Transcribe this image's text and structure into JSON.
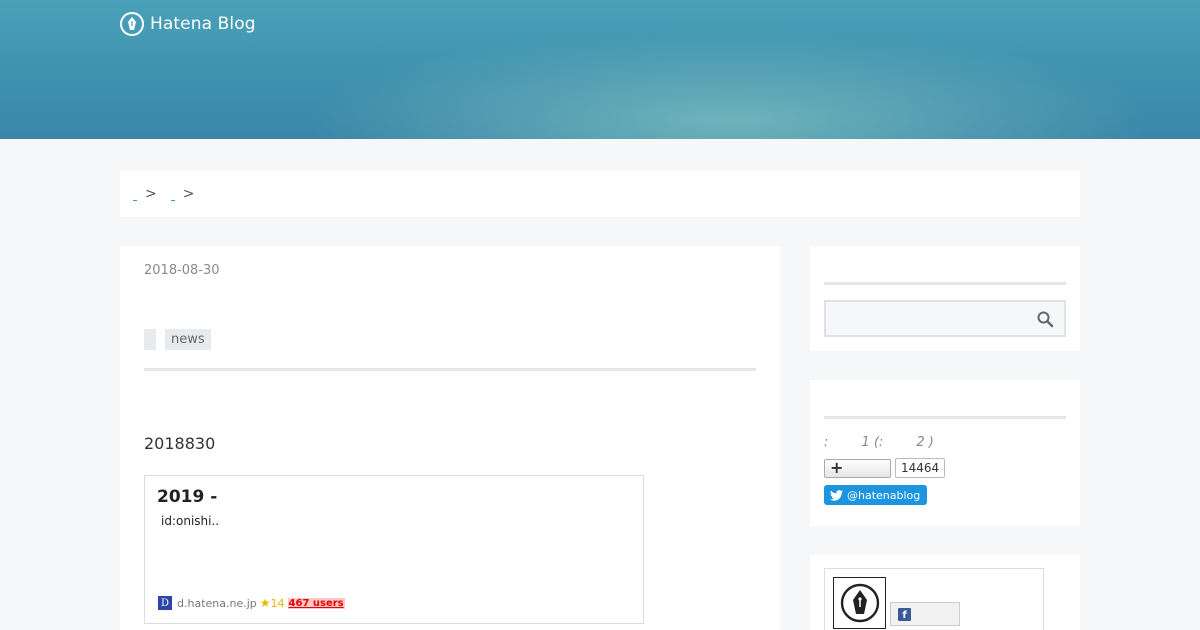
{
  "header": {
    "logo_text": "Hatena Blog",
    "background_color": "#3f90ae"
  },
  "breadcrumb": {
    "separator_1": ">",
    "separator_2": ">"
  },
  "article": {
    "date": "2018-08-30",
    "category": "news",
    "body_text": "2018830",
    "embed": {
      "title": "2019 -",
      "description": "id:onishi..",
      "favicon_letter": "D",
      "domain": "d.hatena.ne.jp",
      "star_glyph": "★",
      "star_count": "14",
      "users": "467 users"
    }
  },
  "sidebar": {
    "search": {
      "placeholder": "",
      "icon": "search-icon"
    },
    "profile": {
      "stats_line": ":        1 (:        2 )",
      "follow_count": "14464",
      "twitter_label": "@hatenablog",
      "twitter_color": "#1b95e0"
    },
    "card": {
      "facebook_letter": "f",
      "facebook_color": "#3b5998"
    }
  }
}
